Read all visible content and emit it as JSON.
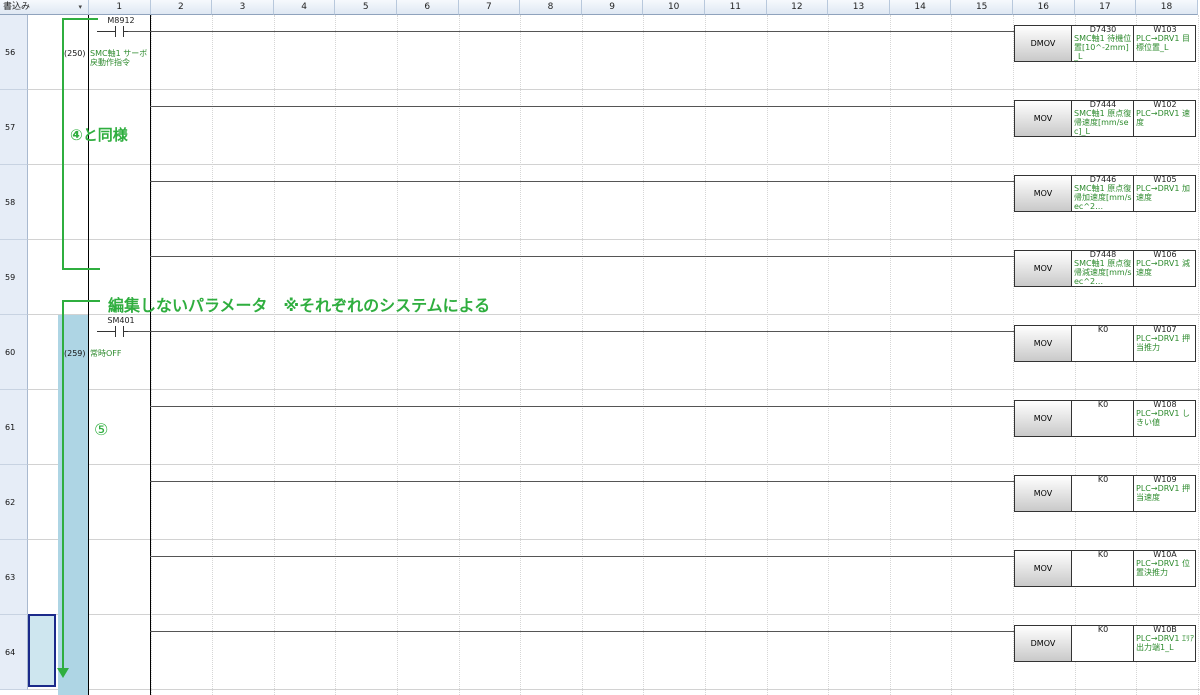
{
  "header": {
    "mode_label": "書込み",
    "columns": [
      "1",
      "2",
      "3",
      "4",
      "5",
      "6",
      "7",
      "8",
      "9",
      "10",
      "11",
      "12",
      "13",
      "14",
      "15",
      "16",
      "17",
      "18"
    ]
  },
  "rows": [
    "56",
    "57",
    "58",
    "59",
    "60",
    "61",
    "62",
    "63",
    "64"
  ],
  "contacts": [
    {
      "device": "M8912",
      "step": "(250)",
      "comment": "SMC軸1 サーボ戻動作指令"
    },
    {
      "device": "SM401",
      "step": "(259)",
      "comment": "常時OFF"
    }
  ],
  "instructions": [
    {
      "op": "DMOV",
      "src": "D7430",
      "src_comment": "SMC軸1 待機位置[10^-2mm]_L",
      "dst": "W103",
      "dst_comment": "PLC→DRV1 目標位置_L"
    },
    {
      "op": "MOV",
      "src": "D7444",
      "src_comment": "SMC軸1 原点復帰速度[mm/sec]_L",
      "dst": "W102",
      "dst_comment": "PLC→DRV1 速度"
    },
    {
      "op": "MOV",
      "src": "D7446",
      "src_comment": "SMC軸1 原点復帰加速度[mm/sec^2…",
      "dst": "W105",
      "dst_comment": "PLC→DRV1 加速度"
    },
    {
      "op": "MOV",
      "src": "D7448",
      "src_comment": "SMC軸1 原点復帰減速度[mm/sec^2…",
      "dst": "W106",
      "dst_comment": "PLC→DRV1 減速度"
    },
    {
      "op": "MOV",
      "src": "K0",
      "src_comment": "",
      "dst": "W107",
      "dst_comment": "PLC→DRV1 押当推力"
    },
    {
      "op": "MOV",
      "src": "K0",
      "src_comment": "",
      "dst": "W108",
      "dst_comment": "PLC→DRV1 しきい値"
    },
    {
      "op": "MOV",
      "src": "K0",
      "src_comment": "",
      "dst": "W109",
      "dst_comment": "PLC→DRV1 押当速度"
    },
    {
      "op": "MOV",
      "src": "K0",
      "src_comment": "",
      "dst": "W10A",
      "dst_comment": "PLC→DRV1 位置決推力"
    },
    {
      "op": "DMOV",
      "src": "K0",
      "src_comment": "",
      "dst": "W10B",
      "dst_comment": "PLC→DRV1 ｴﾘｱ出力端1_L"
    }
  ],
  "annotations": {
    "same_as_4": "④と同様",
    "non_edit": "編集しないパラメータ　※それぞれのシステムによる",
    "num5": "⑤"
  },
  "colors": {
    "accent_green": "#2fae3f",
    "selection": "#aed5e4",
    "comment_green": "#2e8b2e"
  }
}
